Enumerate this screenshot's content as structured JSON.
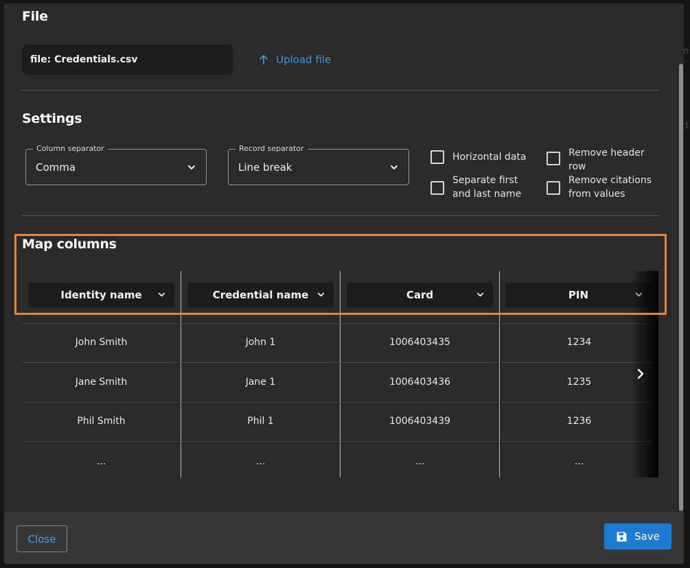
{
  "file_section": {
    "title": "File",
    "file_chip": "file: Credentials.csv",
    "upload_label": "Upload file"
  },
  "settings": {
    "title": "Settings",
    "column_separator": {
      "label": "Column separator",
      "value": "Comma"
    },
    "record_separator": {
      "label": "Record separator",
      "value": "Line break"
    },
    "checkboxes": [
      {
        "label": "Horizontal data",
        "checked": false
      },
      {
        "label": "Remove header row",
        "checked": false
      },
      {
        "label": "Separate first and last name",
        "checked": false
      },
      {
        "label": "Remove citations from values",
        "checked": false
      }
    ]
  },
  "map_columns": {
    "title": "Map columns",
    "headers": [
      "Identity name",
      "Credential name",
      "Card",
      "PIN"
    ],
    "rows": [
      [
        "John Smith",
        "John 1",
        "1006403435",
        "1234"
      ],
      [
        "Jane Smith",
        "Jane 1",
        "1006403436",
        "1235"
      ],
      [
        "Phil Smith",
        "Phil 1",
        "1006403439",
        "1236"
      ],
      [
        "...",
        "...",
        "...",
        "..."
      ]
    ]
  },
  "footer": {
    "close_label": "Close",
    "save_label": "Save"
  },
  "colors": {
    "accent": "#1e7bd4",
    "link": "#3d9be9",
    "highlight": "#f0832c",
    "dialog_bg": "#2a2a2a",
    "footer_bg": "#373737"
  },
  "icons": {
    "upload": "arrow-up-icon",
    "dropdown": "chevron-down-icon",
    "scroll": "chevron-right-icon",
    "save": "floppy-disk-icon"
  }
}
